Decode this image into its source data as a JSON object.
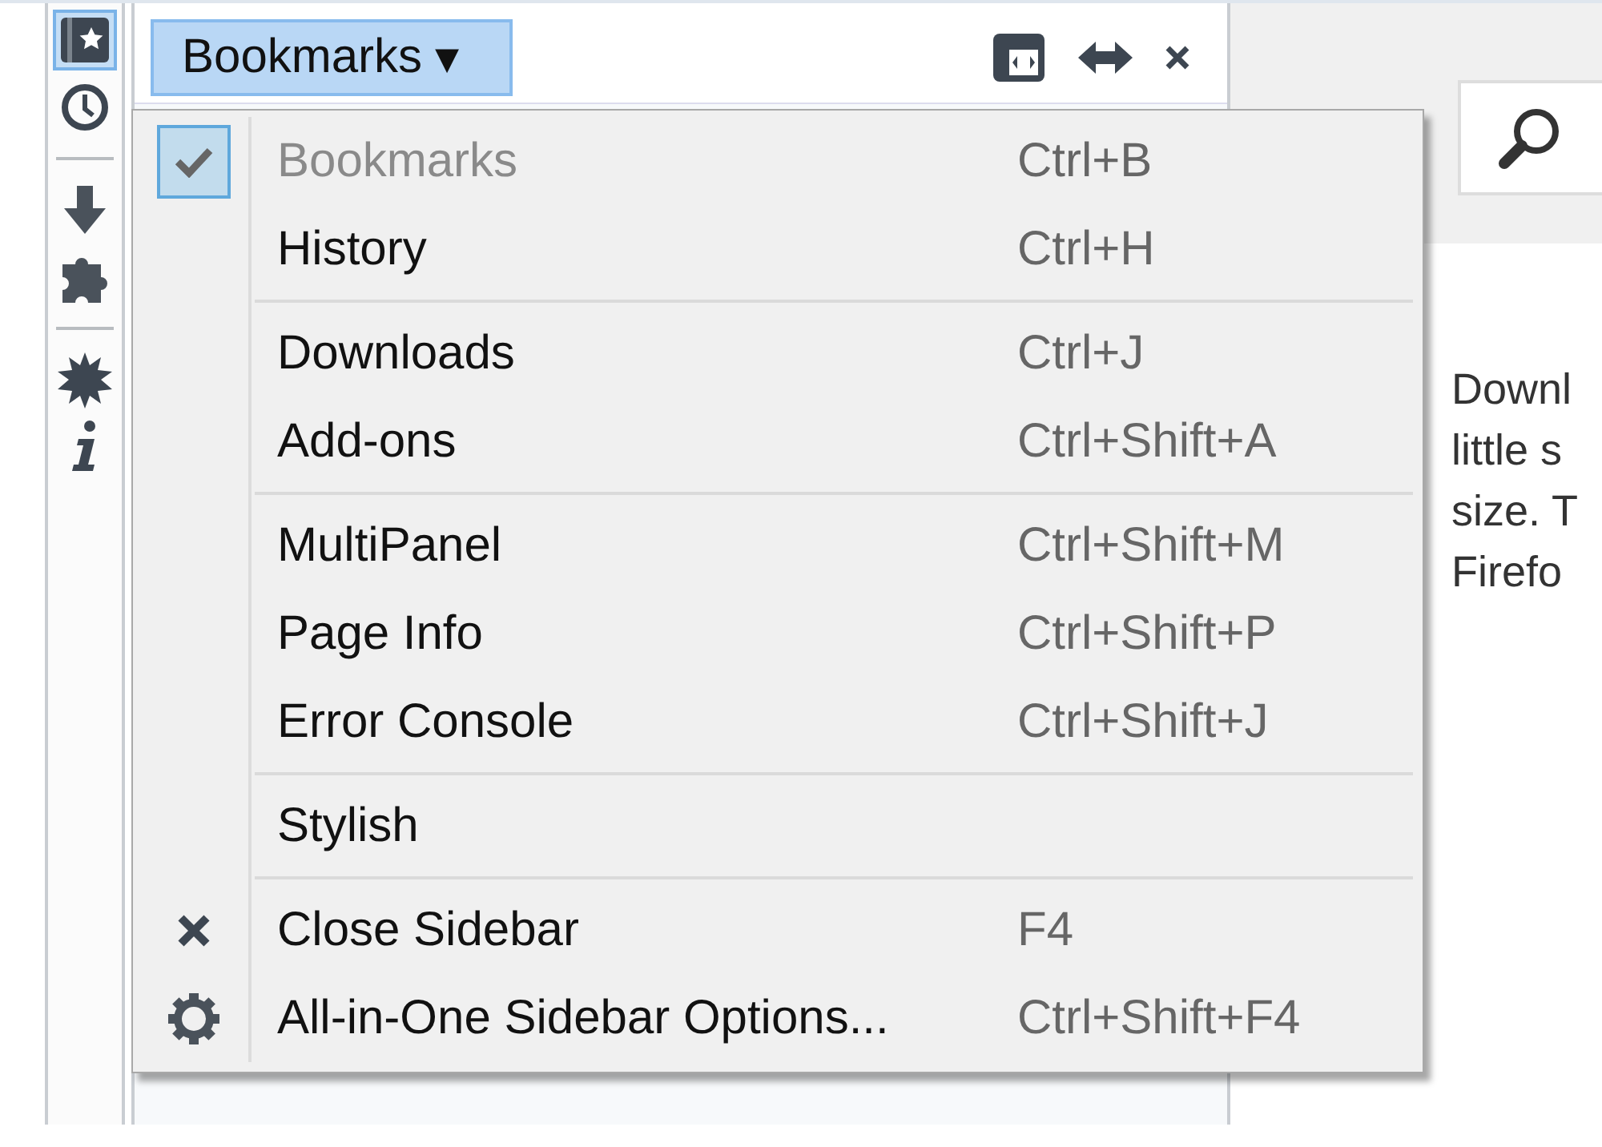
{
  "sidebar_strip": [
    {
      "kind": "bookmarks",
      "selected": true
    },
    {
      "kind": "history",
      "selected": false
    },
    {
      "kind": "separator"
    },
    {
      "kind": "downloads",
      "selected": false
    },
    {
      "kind": "addons",
      "selected": false
    },
    {
      "kind": "separator"
    },
    {
      "kind": "multipanel",
      "selected": false
    },
    {
      "kind": "info",
      "selected": false
    }
  ],
  "sidebar_header": {
    "title": "Bookmarks",
    "caret": "▾"
  },
  "menu": {
    "sections": [
      [
        {
          "label": "Bookmarks",
          "shortcut": "Ctrl+B",
          "checked": true,
          "disabled": true
        },
        {
          "label": "History",
          "shortcut": "Ctrl+H",
          "checked": false,
          "disabled": false
        }
      ],
      [
        {
          "label": "Downloads",
          "shortcut": "Ctrl+J",
          "checked": false,
          "disabled": false
        },
        {
          "label": "Add-ons",
          "shortcut": "Ctrl+Shift+A",
          "checked": false,
          "disabled": false
        }
      ],
      [
        {
          "label": "MultiPanel",
          "shortcut": "Ctrl+Shift+M",
          "checked": false,
          "disabled": false
        },
        {
          "label": "Page Info",
          "shortcut": "Ctrl+Shift+P",
          "checked": false,
          "disabled": false
        },
        {
          "label": "Error Console",
          "shortcut": "Ctrl+Shift+J",
          "checked": false,
          "disabled": false
        }
      ],
      [
        {
          "label": "Stylish",
          "checked": false,
          "disabled": false
        }
      ],
      [
        {
          "label": "Close Sidebar",
          "shortcut": "F4",
          "checked": false,
          "disabled": false,
          "kind": "close"
        },
        {
          "label": "All-in-One Sidebar Options...",
          "shortcut": "Ctrl+Shift+F4",
          "checked": false,
          "disabled": false,
          "kind": "options"
        }
      ]
    ]
  },
  "page": {
    "text_lines": [
      "Downl",
      "little s",
      "size. T",
      "Firefo"
    ]
  }
}
